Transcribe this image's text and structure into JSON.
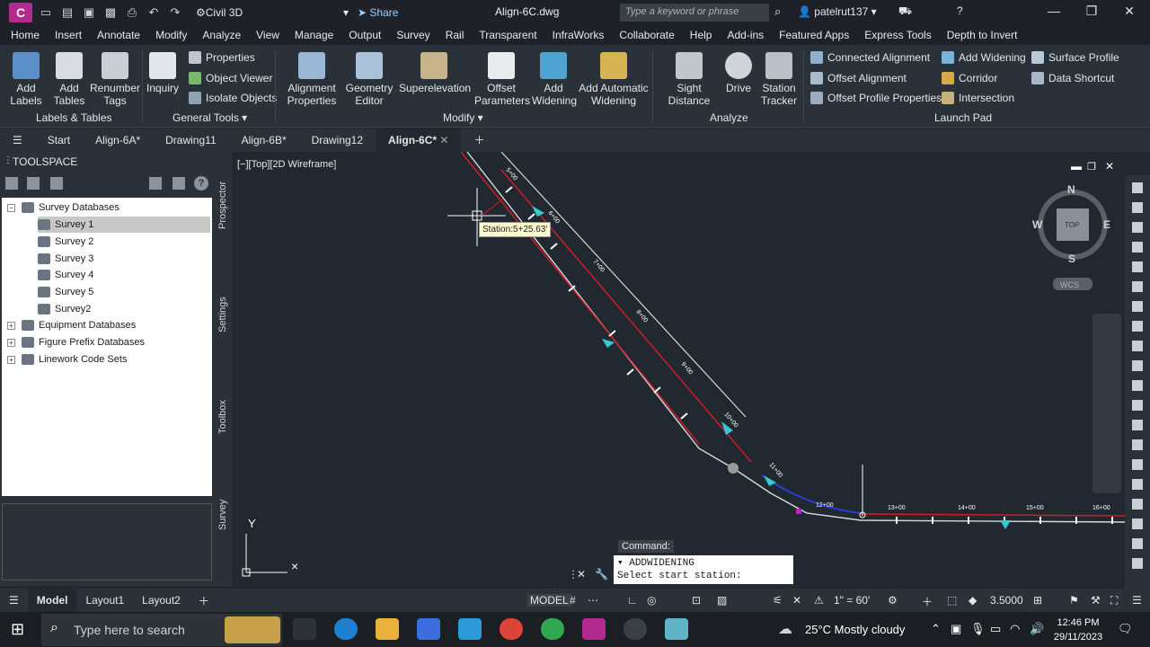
{
  "app": {
    "logo": "C",
    "workspace": "Civil 3D",
    "share": "Share",
    "document_title": "Align-6C.dwg",
    "search_placeholder": "Type a keyword or phrase",
    "user": "patelrut137"
  },
  "menu": [
    "Home",
    "Insert",
    "Annotate",
    "Modify",
    "Analyze",
    "View",
    "Manage",
    "Output",
    "Survey",
    "Rail",
    "Transparent",
    "InfraWorks",
    "Collaborate",
    "Help",
    "Add-ins",
    "Featured Apps",
    "Express Tools",
    "Depth to Invert"
  ],
  "ribbon": {
    "labels_tables": {
      "title": "Labels & Tables",
      "add_labels": "Add\nLabels",
      "add_tables": "Add\nTables",
      "renumber_tags": "Renumber\nTags"
    },
    "general_tools": {
      "title": "General Tools",
      "inquiry": "Inquiry",
      "properties": "Properties",
      "object_viewer": "Object Viewer",
      "isolate_objects": "Isolate Objects"
    },
    "modify": {
      "title": "Modify",
      "alignment_properties": "Alignment\nProperties",
      "geometry_editor": "Geometry\nEditor",
      "superelevation": "Superelevation",
      "offset_parameters": "Offset\nParameters",
      "add_widening": "Add\nWidening",
      "add_automatic_widening": "Add Automatic\nWidening"
    },
    "analyze": {
      "title": "Analyze",
      "sight_distance": "Sight Distance",
      "drive": "Drive",
      "station_tracker": "Station\nTracker"
    },
    "launch_pad": {
      "title": "Launch Pad",
      "connected_alignment": "Connected Alignment",
      "offset_alignment": "Offset Alignment",
      "offset_profile_properties": "Offset Profile Properties",
      "add_widening": "Add Widening",
      "corridor": "Corridor",
      "intersection": "Intersection",
      "surface_profile": "Surface Profile",
      "data_shortcut": "Data Shortcut"
    }
  },
  "doc_tabs": [
    "Start",
    "Align-6A*",
    "Drawing11",
    "Align-6B*",
    "Drawing12",
    "Align-6C*"
  ],
  "toolspace": {
    "title": "TOOLSPACE",
    "tree": [
      "Survey Databases",
      "Survey 1",
      "Survey 2",
      "Survey 3",
      "Survey 4",
      "Survey 5",
      "Survey2",
      "Equipment Databases",
      "Figure Prefix Databases",
      "Linework Code Sets"
    ],
    "side_tabs": [
      "Prospector",
      "Settings",
      "Toolbox",
      "Survey"
    ]
  },
  "viewport": {
    "label": "[−][Top][2D Wireframe]",
    "tooltip": "Station:5+25.63'",
    "compass": {
      "n": "N",
      "s": "S",
      "e": "E",
      "w": "W",
      "top": "TOP",
      "wcs": "WCS"
    },
    "axis_y": "Y",
    "stations": [
      "5+00",
      "6+00",
      "7+00",
      "8+00",
      "9+00",
      "10+00",
      "11+00",
      "12+00",
      "13+00",
      "14+00",
      "15+00",
      "16+00"
    ]
  },
  "command": {
    "label": "Command:",
    "line1": "ADDWIDENING",
    "line2": "Select start station:"
  },
  "status": {
    "tabs": [
      "Model",
      "Layout1",
      "Layout2"
    ],
    "model": "MODEL",
    "scale": "1\" = 60'",
    "lineweight": "3.5000"
  },
  "taskbar": {
    "search": "Type here to search",
    "weather": "25°C  Mostly cloudy",
    "time": "12:46 PM",
    "date": "29/11/2023"
  }
}
